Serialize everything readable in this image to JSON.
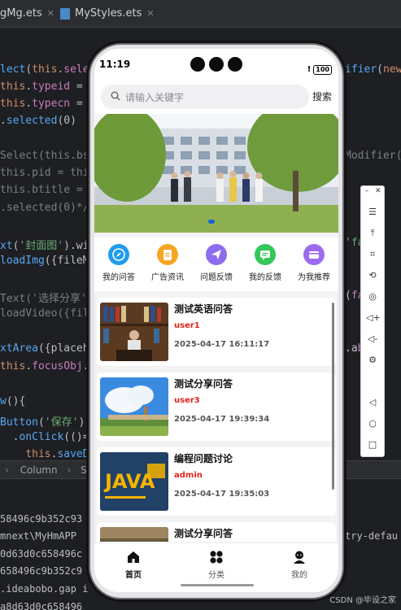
{
  "ide": {
    "tabs": [
      {
        "label": "gMg.ets"
      },
      {
        "label": "MyStyles.ets"
      }
    ],
    "statusbar": {
      "items": [
        "Column",
        "Scro"
      ]
    }
  },
  "phone": {
    "status": {
      "time": "11:19",
      "alert": "!",
      "battery": "100"
    },
    "search": {
      "placeholder": "请输入关键字",
      "button": "搜索"
    },
    "categories": [
      {
        "label": "我的问答",
        "color": "#1f9cf0",
        "icon": "compass-icon"
      },
      {
        "label": "广告资讯",
        "color": "#f5a623",
        "icon": "clipboard-icon"
      },
      {
        "label": "问题反馈",
        "color": "#8e6cf0",
        "icon": "paper-plane-icon"
      },
      {
        "label": "我的反馈",
        "color": "#34c759",
        "icon": "chat-bubble-icon"
      },
      {
        "label": "为我推荐",
        "color": "#9b6cf0",
        "icon": "card-icon"
      }
    ],
    "posts": [
      {
        "title": "测试英语问答",
        "user": "user1",
        "time": "2025-04-17 16:11:17"
      },
      {
        "title": "测试分享问答",
        "user": "user3",
        "time": "2025-04-17 19:39:34"
      },
      {
        "title": "编程问题讨论",
        "user": "admin",
        "time": "2025-04-17 19:35:03"
      },
      {
        "title": "测试分享问答",
        "user": "",
        "time": ""
      }
    ],
    "tabbar": [
      {
        "label": "首页",
        "active": true,
        "color": "#111111"
      },
      {
        "label": "分类",
        "active": false,
        "color": "#555555"
      },
      {
        "label": "我的",
        "active": false,
        "color": "#555555"
      }
    ]
  },
  "watermark": "CSDN @毕设之家"
}
